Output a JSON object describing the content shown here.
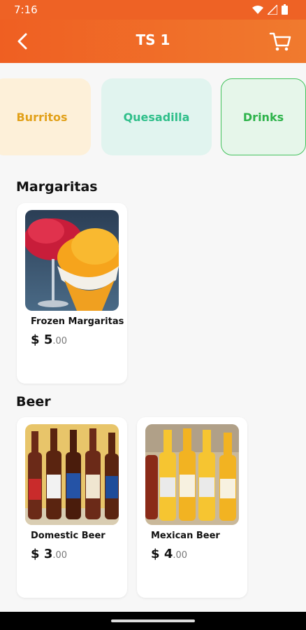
{
  "status": {
    "time": "7:16"
  },
  "header": {
    "title": "TS 1"
  },
  "categories": [
    {
      "label": "Burritos",
      "bg": "#fdf0d9",
      "color": "#e2a11a"
    },
    {
      "label": "Quesadilla",
      "bg": "#e1f4ef",
      "color": "#2fbf8a"
    },
    {
      "label": "Drinks",
      "bg": "#e6f6ea",
      "color": "#2db34a"
    }
  ],
  "sections": [
    {
      "title": "Margaritas",
      "items": [
        {
          "name": "Frozen Margaritas",
          "price_symbol": "$",
          "price_whole": "5",
          "price_cents": ".00"
        }
      ]
    },
    {
      "title": "Beer",
      "items": [
        {
          "name": "Domestic Beer",
          "price_symbol": "$",
          "price_whole": "3",
          "price_cents": ".00"
        },
        {
          "name": "Mexican Beer",
          "price_symbol": "$",
          "price_whole": "4",
          "price_cents": ".00"
        }
      ]
    }
  ],
  "colors": {
    "accent": "#ee6225"
  }
}
